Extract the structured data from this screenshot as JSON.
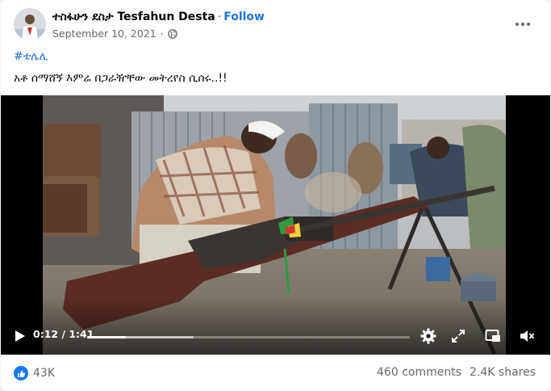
{
  "post": {
    "author": "ተስፋሁን ደስታ Tesfahun Desta",
    "separator": "·",
    "follow_label": "Follow",
    "date": "September 10, 2021",
    "dot_after_date": "·",
    "hashtag": "#ቴሌሊ",
    "caption": "አቶ ሰማሸኝ እምሬ በጋራዥቸው መትረየስ ሲሰሩ..!!"
  },
  "video": {
    "time": "0:12 / 1:41",
    "progress_fraction": 0.119,
    "buffered_fraction": 0.33
  },
  "footer": {
    "reaction_count": "43K",
    "comments": "460 comments",
    "shares": "2.4K shares"
  },
  "colors": {
    "accent": "#1b74e4",
    "like_blue": "#1877f2",
    "secondary_text": "#65676b"
  },
  "icons": [
    "avatar",
    "globe-icon",
    "more-options-icon",
    "play-icon",
    "settings-gear-icon",
    "fullscreen-icon",
    "picture-in-picture-icon",
    "volume-muted-icon",
    "like-reaction-icon"
  ]
}
